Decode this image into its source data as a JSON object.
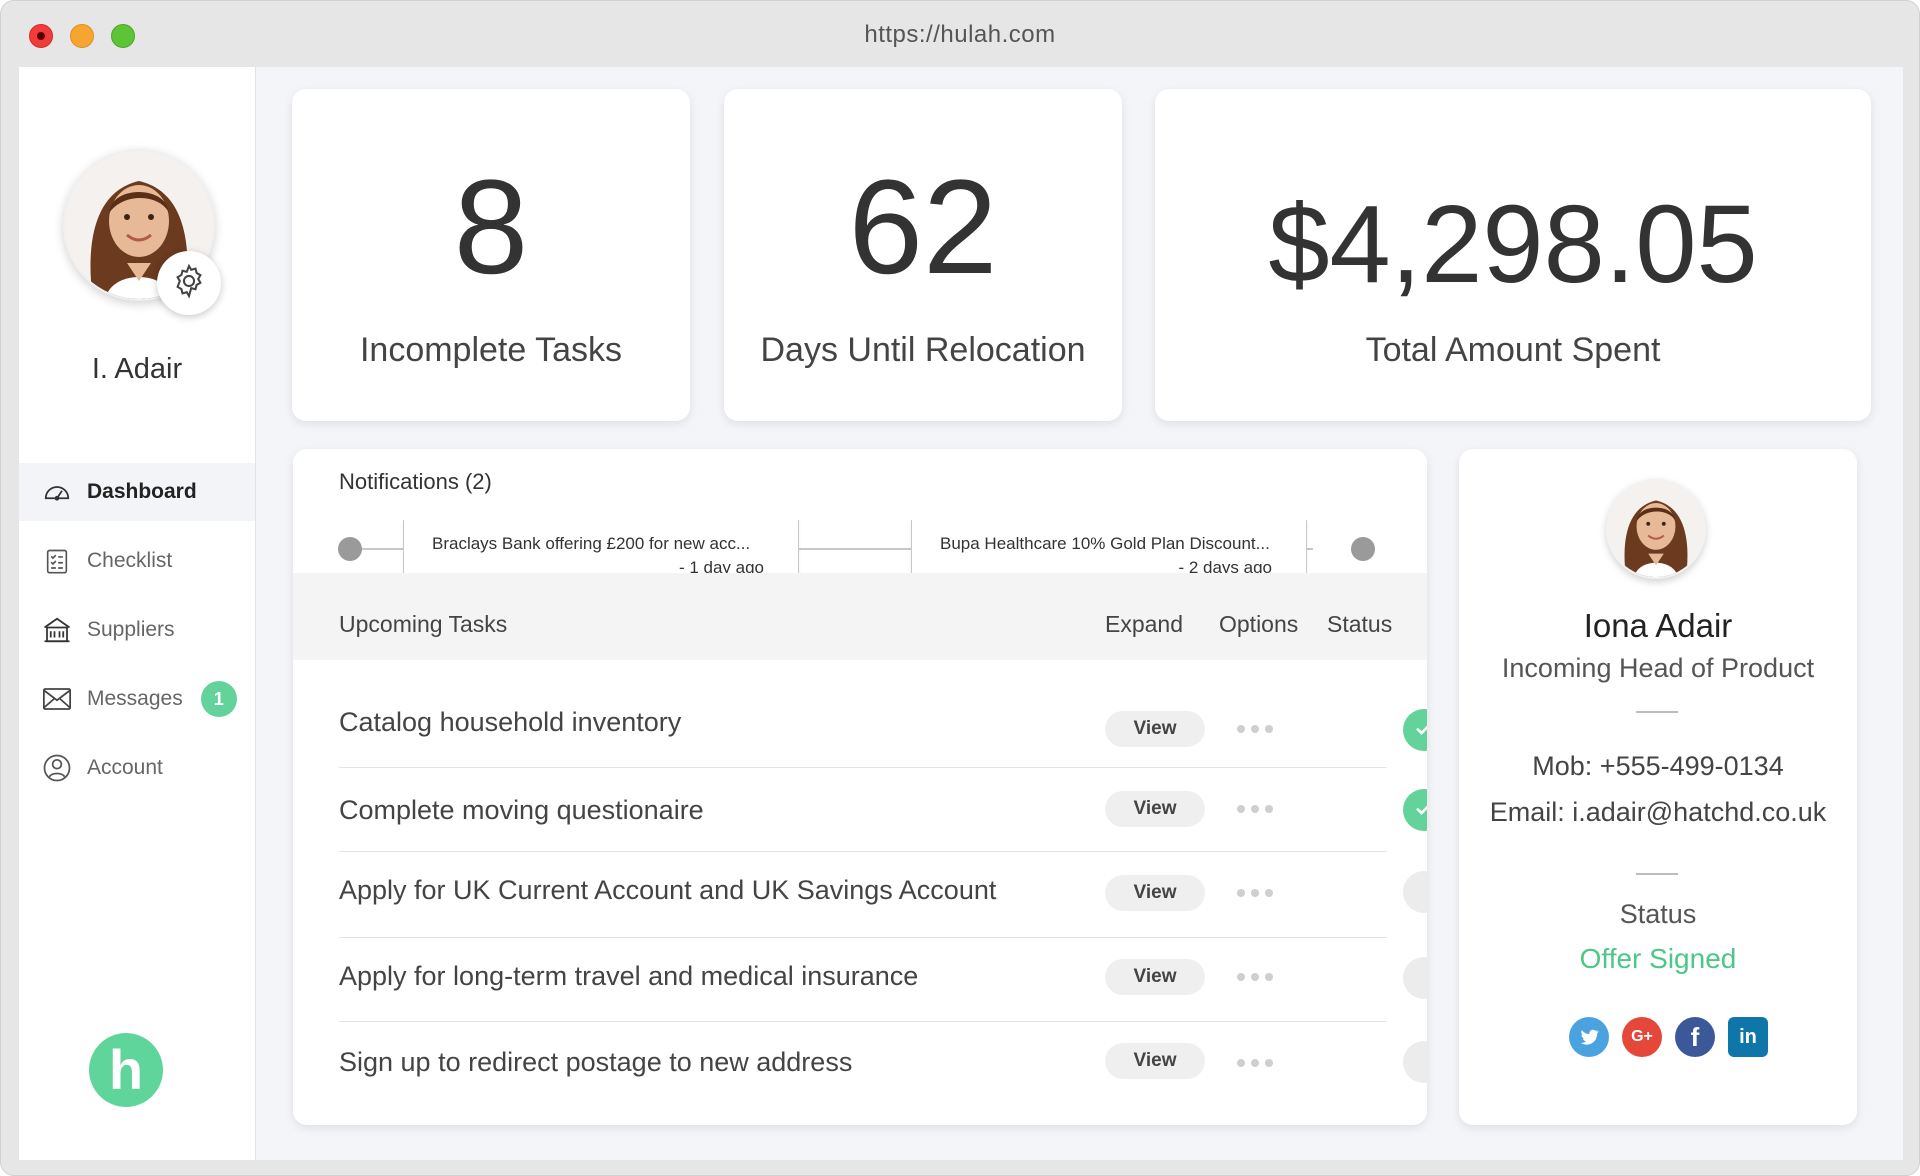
{
  "browser": {
    "url": "https://hulah.com"
  },
  "sidebar": {
    "user_name": "I. Adair",
    "nav": [
      {
        "label": "Dashboard",
        "icon": "gauge-icon",
        "active": true
      },
      {
        "label": "Checklist",
        "icon": "checklist-icon"
      },
      {
        "label": "Suppliers",
        "icon": "building-icon"
      },
      {
        "label": "Messages",
        "icon": "envelope-icon",
        "badge": "1"
      },
      {
        "label": "Account",
        "icon": "user-circle-icon"
      }
    ],
    "logo_letter": "h"
  },
  "stats": [
    {
      "value": "8",
      "label": "Incomplete Tasks"
    },
    {
      "value": "62",
      "label": "Days Until Relocation"
    },
    {
      "value": "$4,298.05",
      "label": "Total Amount Spent"
    }
  ],
  "notifications": {
    "title": "Notifications (2)",
    "items": [
      {
        "text": "Braclays Bank offering £200 for new acc...",
        "time": "- 1 day ago"
      },
      {
        "text": "Bupa Healthcare 10% Gold Plan Discount...",
        "time": "- 2 days ago"
      }
    ]
  },
  "tasks": {
    "title": "Upcoming Tasks",
    "columns": {
      "expand": "Expand",
      "options": "Options",
      "status": "Status"
    },
    "view_label": "View",
    "rows": [
      {
        "text": "Catalog household inventory",
        "done": true
      },
      {
        "text": "Complete moving questionaire",
        "done": true
      },
      {
        "text": "Apply for UK Current Account and UK Savings Account",
        "done": false
      },
      {
        "text": "Apply for long-term travel and medical insurance",
        "done": false
      },
      {
        "text": "Sign up to redirect postage to new address",
        "done": false
      }
    ]
  },
  "profile": {
    "name": "Iona Adair",
    "role": "Incoming Head of Product",
    "mobile": "Mob: +555-499-0134",
    "email": "Email: i.adair@hatchd.co.uk",
    "status_label": "Status",
    "status_value": "Offer Signed",
    "socials": [
      {
        "name": "twitter-icon",
        "color": "#4aa3df"
      },
      {
        "name": "google-plus-icon",
        "color": "#e5473a",
        "text": "G+"
      },
      {
        "name": "facebook-icon",
        "color": "#3b5998",
        "text": "f"
      },
      {
        "name": "linkedin-icon",
        "color": "#0e76a8",
        "text": "in"
      }
    ]
  },
  "colors": {
    "accent": "#63d39b",
    "status_green": "#4cc787"
  }
}
